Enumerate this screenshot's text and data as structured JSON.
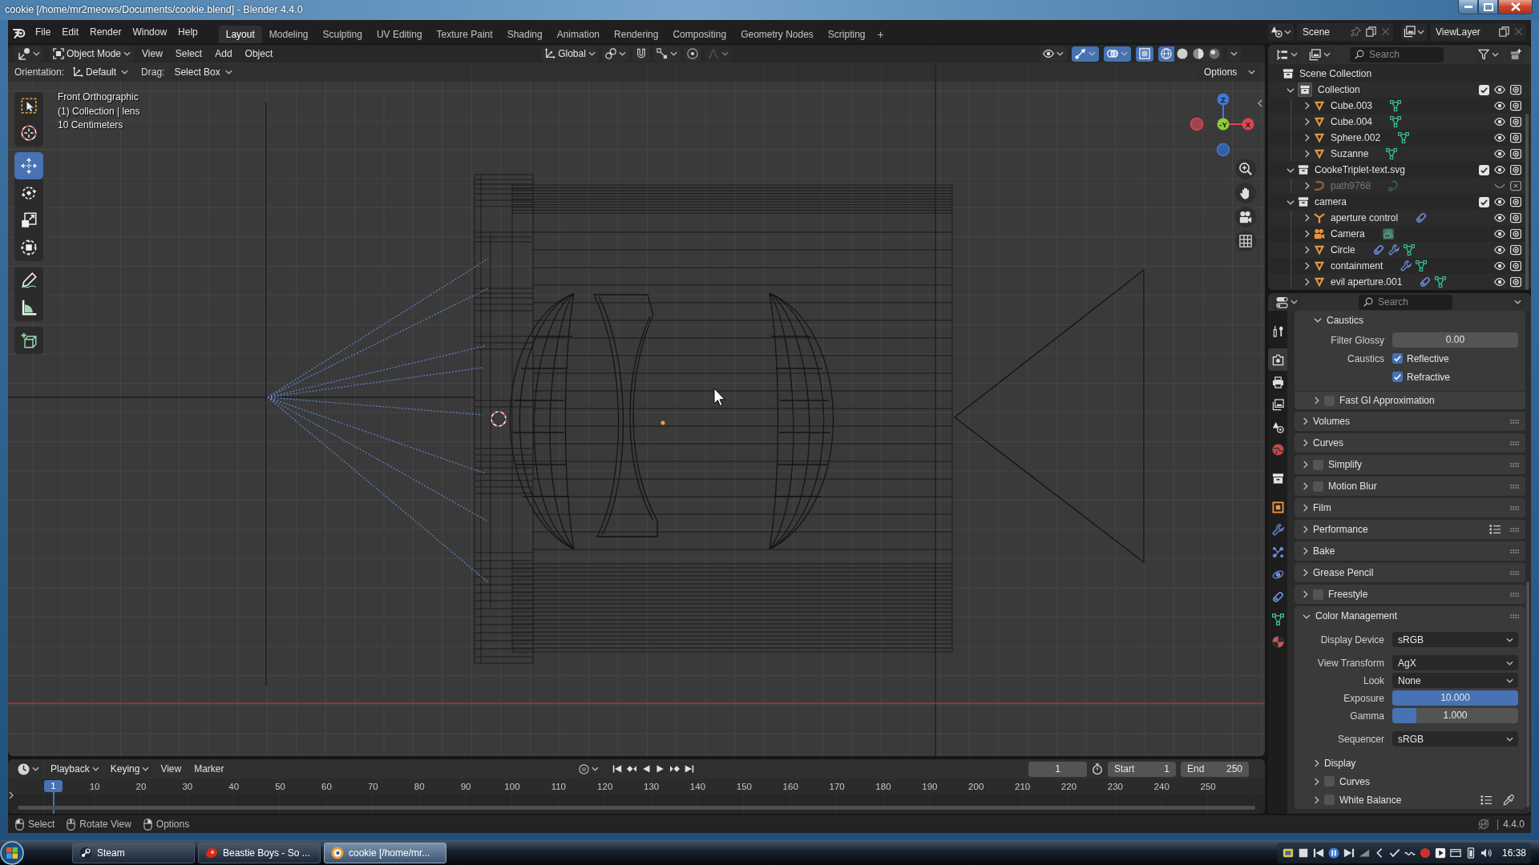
{
  "window": {
    "title": "cookie [/home/mr2meows/Documents/cookie.blend] - Blender 4.4.0"
  },
  "top_bar": {
    "menus": [
      "File",
      "Edit",
      "Render",
      "Window",
      "Help"
    ],
    "workspaces": [
      {
        "label": "Layout",
        "selected": true
      },
      {
        "label": "Modeling",
        "selected": false
      },
      {
        "label": "Sculpting",
        "selected": false
      },
      {
        "label": "UV Editing",
        "selected": false
      },
      {
        "label": "Texture Paint",
        "selected": false
      },
      {
        "label": "Shading",
        "selected": false
      },
      {
        "label": "Animation",
        "selected": false
      },
      {
        "label": "Rendering",
        "selected": false
      },
      {
        "label": "Compositing",
        "selected": false
      },
      {
        "label": "Geometry Nodes",
        "selected": false
      },
      {
        "label": "Scripting",
        "selected": false
      }
    ],
    "add_workspace": "+",
    "scene": "Scene",
    "view_layer": "ViewLayer"
  },
  "viewport": {
    "mode": "Object Mode",
    "menus": [
      "View",
      "Select",
      "Add",
      "Object"
    ],
    "transform_orientation": "Global",
    "toggles": [
      {
        "kind": "gizmos",
        "on": true
      },
      {
        "kind": "overlays",
        "on": true
      },
      {
        "kind": "xray",
        "on": true
      }
    ],
    "shading": [
      {
        "kind": "wireframe",
        "selected": true
      },
      {
        "kind": "solid",
        "selected": false
      },
      {
        "kind": "material",
        "selected": false
      },
      {
        "kind": "rendered",
        "selected": false
      }
    ],
    "tool_settings": {
      "orientation_label": "Orientation:",
      "orientation": "Default",
      "drag_label": "Drag:",
      "drag": "Select Box",
      "options": "Options"
    },
    "tool_groups": [
      [
        {
          "kind": "select",
          "selected": false
        },
        {
          "kind": "cursor",
          "selected": false
        }
      ],
      [
        {
          "kind": "move",
          "selected": true
        },
        {
          "kind": "rotate",
          "selected": false
        },
        {
          "kind": "scale",
          "selected": false
        },
        {
          "kind": "transform",
          "selected": false
        }
      ],
      [
        {
          "kind": "annotate",
          "selected": false
        },
        {
          "kind": "measure",
          "selected": false
        }
      ],
      [
        {
          "kind": "add-cube",
          "selected": false
        }
      ]
    ],
    "info": [
      "Front Orthographic",
      "(1) Collection | lens",
      "10 Centimeters"
    ],
    "gizmo_axes": [
      "Z",
      "-Y",
      "X"
    ]
  },
  "outliner": {
    "search": {
      "placeholder": "Search"
    },
    "root": "Scene Collection",
    "items": [
      {
        "kind": "collection",
        "name": "Collection",
        "expanded": true,
        "selected": true,
        "checked": true,
        "hidden": false,
        "children": [
          {
            "kind": "mesh",
            "name": "Cube.003",
            "expanded": false,
            "selected": false,
            "hidden": false,
            "extras": [
              {
                "kind": "mesh-data"
              }
            ]
          },
          {
            "kind": "mesh",
            "name": "Cube.004",
            "expanded": false,
            "selected": false,
            "hidden": false,
            "extras": [
              {
                "kind": "mesh-data"
              }
            ]
          },
          {
            "kind": "mesh",
            "name": "Sphere.002",
            "expanded": false,
            "selected": false,
            "hidden": false,
            "extras": [
              {
                "kind": "mesh-data"
              }
            ]
          },
          {
            "kind": "mesh",
            "name": "Suzanne",
            "expanded": false,
            "selected": false,
            "hidden": false,
            "extras": [
              {
                "kind": "mesh-data"
              }
            ]
          }
        ]
      },
      {
        "kind": "collection",
        "name": "CookeTriplet-text.svg",
        "expanded": true,
        "selected": false,
        "checked": true,
        "hidden": false,
        "children": [
          {
            "kind": "curve",
            "name": "path9768",
            "expanded": false,
            "selected": false,
            "hidden": true,
            "extras": [
              {
                "kind": "curve-data"
              }
            ]
          }
        ]
      },
      {
        "kind": "collection",
        "name": "camera",
        "expanded": true,
        "selected": false,
        "checked": true,
        "hidden": false,
        "children": [
          {
            "kind": "empty",
            "name": "aperture control",
            "expanded": false,
            "selected": false,
            "hidden": false,
            "extras": [
              {
                "kind": "constraint"
              }
            ]
          },
          {
            "kind": "camera",
            "name": "Camera",
            "expanded": false,
            "selected": false,
            "hidden": false,
            "extras": [
              {
                "kind": "camera-data"
              }
            ]
          },
          {
            "kind": "mesh",
            "name": "Circle",
            "expanded": false,
            "selected": false,
            "hidden": false,
            "extras": [
              {
                "kind": "constraint"
              },
              {
                "kind": "modifier"
              },
              {
                "kind": "mesh-data"
              }
            ]
          },
          {
            "kind": "mesh",
            "name": "containment",
            "expanded": false,
            "selected": false,
            "hidden": false,
            "extras": [
              {
                "kind": "modifier"
              },
              {
                "kind": "mesh-data"
              }
            ]
          },
          {
            "kind": "mesh",
            "name": "evil aperture.001",
            "expanded": false,
            "selected": false,
            "hidden": false,
            "extras": [
              {
                "kind": "constraint"
              },
              {
                "kind": "mesh-data"
              }
            ]
          }
        ]
      }
    ]
  },
  "properties": {
    "search": {
      "placeholder": "Search"
    },
    "tab_groups": [
      [
        {
          "kind": "tool",
          "selected": false
        }
      ],
      [
        {
          "kind": "render",
          "selected": true
        },
        {
          "kind": "output",
          "selected": false
        },
        {
          "kind": "view-layer",
          "selected": false
        },
        {
          "kind": "scene",
          "selected": false
        },
        {
          "kind": "world",
          "selected": false
        }
      ],
      [
        {
          "kind": "collection",
          "selected": false
        }
      ],
      [
        {
          "kind": "object",
          "selected": false
        },
        {
          "kind": "modifiers",
          "selected": false
        },
        {
          "kind": "particles",
          "selected": false
        },
        {
          "kind": "physics",
          "selected": false
        },
        {
          "kind": "constraints",
          "selected": false
        },
        {
          "kind": "data",
          "selected": false
        },
        {
          "kind": "material",
          "selected": false
        }
      ]
    ],
    "panels": [
      {
        "kind": "open",
        "subpanels": [
          {
            "kind": "subpanel",
            "label": "Caustics",
            "expanded": true,
            "rows": [
              {
                "kind": "number",
                "label": "Filter Glossy",
                "value": "0.00"
              },
              {
                "kind": "checkbox",
                "label": "Caustics",
                "text": "Reflective",
                "checked": true
              },
              {
                "kind": "checkbox",
                "text": "Refractive",
                "checked": true
              }
            ]
          },
          {
            "kind": "toggle-subpanel",
            "label": "Fast GI Approximation",
            "expanded": false,
            "checked": false
          }
        ]
      },
      {
        "kind": "panel",
        "label": "Volumes",
        "expanded": false
      },
      {
        "kind": "panel",
        "label": "Curves",
        "expanded": false
      },
      {
        "kind": "toggle-panel",
        "label": "Simplify",
        "expanded": false,
        "checked": false
      },
      {
        "kind": "toggle-panel",
        "label": "Motion Blur",
        "expanded": false,
        "checked": false
      },
      {
        "kind": "panel",
        "label": "Film",
        "expanded": false
      },
      {
        "kind": "panel",
        "label": "Performance",
        "expanded": false,
        "header_tools": [
          {
            "kind": "presets"
          }
        ]
      },
      {
        "kind": "panel",
        "label": "Bake",
        "expanded": false
      },
      {
        "kind": "panel",
        "label": "Grease Pencil",
        "expanded": false
      },
      {
        "kind": "toggle-panel",
        "label": "Freestyle",
        "expanded": false,
        "checked": false
      },
      {
        "kind": "panel",
        "label": "Color Management",
        "expanded": true,
        "groups": [
          [
            {
              "kind": "dropdown",
              "label": "Display Device",
              "value": "sRGB"
            }
          ],
          [
            {
              "kind": "dropdown",
              "label": "View Transform",
              "value": "AgX"
            },
            {
              "kind": "dropdown",
              "label": "Look",
              "value": "None"
            },
            {
              "kind": "slider",
              "label": "Exposure",
              "value": "10.000",
              "level": 1
            },
            {
              "kind": "slider",
              "label": "Gamma",
              "value": "1.000",
              "level": 0.19
            }
          ],
          [
            {
              "kind": "dropdown",
              "label": "Sequencer",
              "value": "sRGB"
            }
          ]
        ],
        "subpanels": [
          {
            "kind": "subpanel",
            "label": "Display",
            "expanded": false
          },
          {
            "kind": "toggle-subpanel",
            "label": "Curves",
            "expanded": false,
            "checked": false
          },
          {
            "kind": "toggle-subpanel",
            "label": "White Balance",
            "expanded": false,
            "checked": false,
            "header_tools": [
              {
                "kind": "presets"
              },
              {
                "kind": "eyedropper"
              }
            ]
          }
        ]
      }
    ]
  },
  "timeline": {
    "menus": [
      {
        "label": "Playback",
        "kind": "dropdown"
      },
      {
        "label": "Keying",
        "kind": "dropdown"
      },
      {
        "label": "View",
        "kind": "menu"
      },
      {
        "label": "Marker",
        "kind": "menu"
      }
    ],
    "frame": "1",
    "start_label": "Start",
    "start": "1",
    "end_label": "End",
    "end": "250",
    "playhead": "1",
    "ticks": [
      "10",
      "20",
      "30",
      "40",
      "50",
      "60",
      "70",
      "80",
      "90",
      "100",
      "110",
      "120",
      "130",
      "140",
      "150",
      "160",
      "170",
      "180",
      "190",
      "200",
      "210",
      "220",
      "230",
      "240",
      "250"
    ]
  },
  "status_bar": {
    "hints": [
      {
        "kind": "left",
        "label": "Select"
      },
      {
        "kind": "middle",
        "label": "Rotate View"
      },
      {
        "kind": "right",
        "label": "Options"
      }
    ],
    "version": "4.4.0"
  },
  "taskbar": {
    "tasks": [
      {
        "kind": "steam",
        "label": "Steam",
        "selected": false
      },
      {
        "kind": "media",
        "label": "Beastie Boys - So ...",
        "selected": false
      },
      {
        "kind": "blender",
        "label": "cookie [/home/mr...",
        "selected": true
      }
    ],
    "clock": "16:38"
  }
}
